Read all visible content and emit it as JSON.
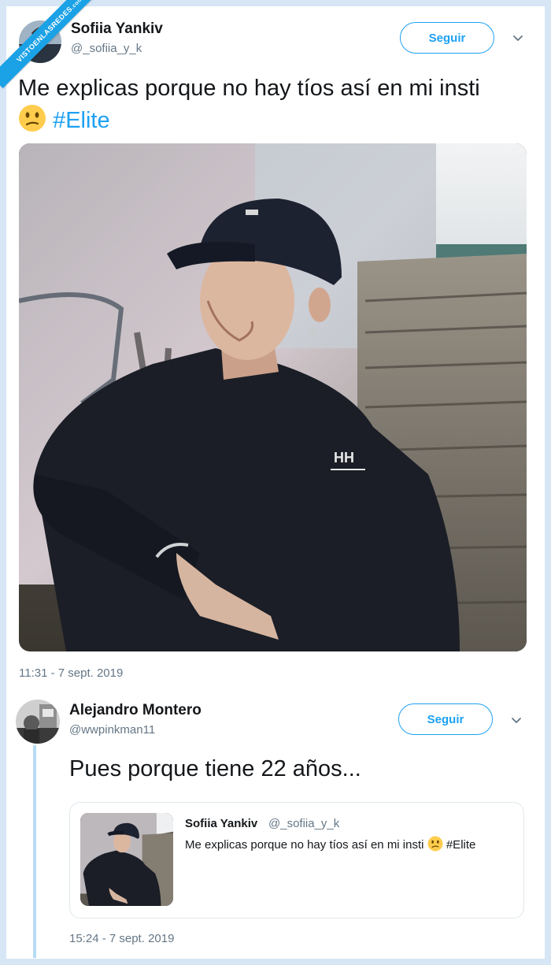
{
  "watermark": {
    "text": "VISTOENLASREDES",
    "sub": ".com"
  },
  "tweet": {
    "author_name": "Sofiia Yankiv",
    "author_handle": "@_sofiia_y_k",
    "follow_label": "Seguir",
    "text": "Me explicas porque no hay tíos así en mi insti",
    "emoji": "confused-face-emoji",
    "hashtag": "#Elite",
    "image": "photo-young-man-black-cap-sitting-on-stairs",
    "timestamp": "11:31 - 7 sept. 2019"
  },
  "reply": {
    "author_name": "Alejandro Montero",
    "author_handle": "@wwpinkman11",
    "follow_label": "Seguir",
    "text": "Pues porque tiene 22 años...",
    "timestamp": "15:24 - 7 sept. 2019",
    "quote": {
      "author_name": "Sofiia Yankiv",
      "author_handle": "@_sofiia_y_k",
      "text": "Me explicas porque no hay tíos así en mi insti",
      "hashtag": "#Elite"
    }
  },
  "colors": {
    "accent": "#1da1f2",
    "muted": "#657786",
    "thread": "#b7dbf4",
    "ribbon": "#1aa1e6"
  }
}
